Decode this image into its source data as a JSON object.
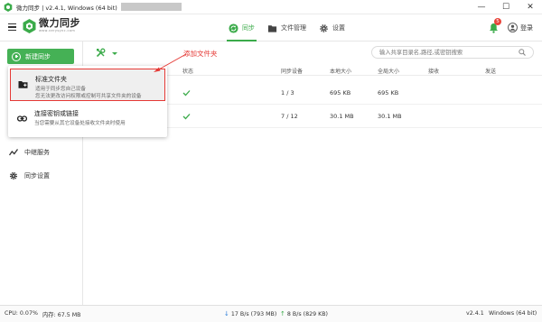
{
  "window": {
    "title": "微力同步 | v2.4.1, Windows (64 bit)",
    "controls": [
      "—",
      "☐",
      "✕"
    ]
  },
  "header": {
    "logo_cn": "微力同步",
    "logo_en": "www.verysync.com",
    "tabs": [
      {
        "label": "同步",
        "icon": "sync-icon",
        "active": true
      },
      {
        "label": "文件管理",
        "icon": "file-manager-icon",
        "active": false
      },
      {
        "label": "设置",
        "icon": "gear-icon",
        "active": false
      }
    ],
    "notification_count": "5",
    "login_label": "登录"
  },
  "sidebar": {
    "new_button": "新建同步",
    "items": [
      {
        "label": "中继服务",
        "icon": "relay-chart-icon"
      },
      {
        "label": "同步设置",
        "icon": "gear-icon"
      }
    ]
  },
  "toolbar": {
    "search_placeholder": "输入共享目录名,路径,或密钥搜索"
  },
  "table": {
    "columns": [
      "状态",
      "同步设备",
      "本地大小",
      "全局大小",
      "接收",
      "发送"
    ],
    "rows": [
      {
        "status": "ok",
        "devices": "1 / 3",
        "local": "695 KB",
        "global": "695 KB",
        "recv": "",
        "send": ""
      },
      {
        "status": "ok",
        "devices": "7 / 12",
        "local": "30.1 MB",
        "global": "30.1 MB",
        "recv": "",
        "send": ""
      }
    ]
  },
  "dropdown": {
    "items": [
      {
        "title": "标准文件夹",
        "desc1": "适用于同步您自己设备",
        "desc2": "您无法更改访问权限或控制可共享文件夹的设备",
        "icon": "folder-add-icon",
        "selected": true
      },
      {
        "title": "连接密钥或链接",
        "desc1": "当您需要从其它设备处接收文件夹时使用",
        "desc2": "",
        "icon": "link-icon",
        "selected": false
      }
    ]
  },
  "annotation": {
    "text": "添加文件夹",
    "color": "#e53935"
  },
  "statusbar": {
    "cpu": "CPU: 0.07%",
    "memory": "内存: 67.5 MB",
    "download": "17 B/s (793 MB)",
    "upload": "8 B/s (829 KB)",
    "version": "v2.4.1",
    "platform": "Windows (64 bit)"
  },
  "colors": {
    "accent": "#45b155",
    "badge": "#e8443a",
    "annotation": "#e53935"
  }
}
